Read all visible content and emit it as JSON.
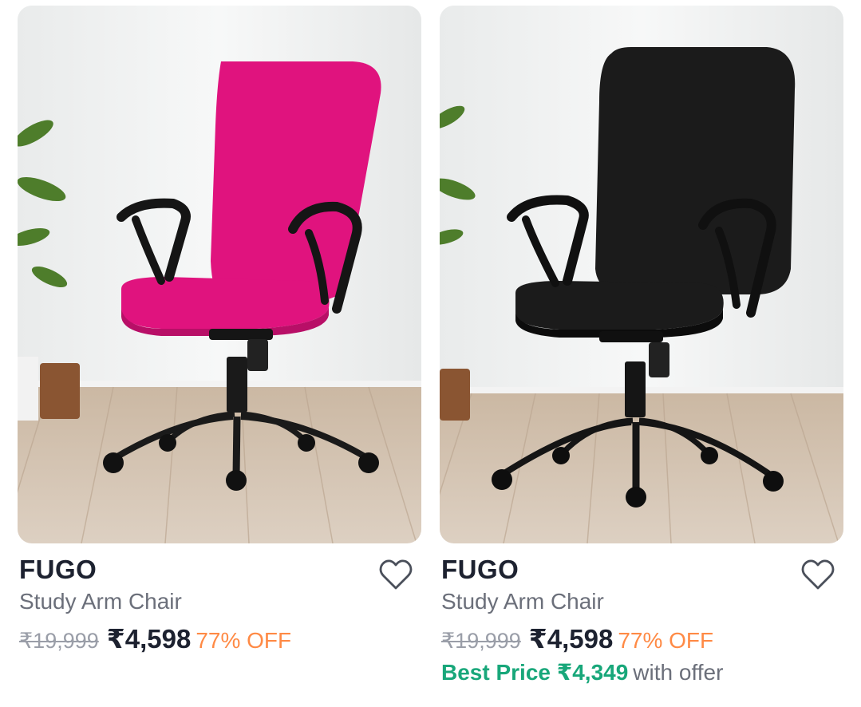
{
  "products": [
    {
      "brand": "FUGO",
      "title": "Study Arm Chair",
      "mrp": "₹19,999",
      "price": "₹4,598",
      "discount": "77% OFF",
      "chair_color": "#e0137e",
      "chair_color_dark": "#b80f67"
    },
    {
      "brand": "FUGO",
      "title": "Study Arm Chair",
      "mrp": "₹19,999",
      "price": "₹4,598",
      "discount": "77% OFF",
      "best_price": "Best Price ₹4,349",
      "best_price_suffix": "with offer",
      "chair_color": "#1b1b1b",
      "chair_color_dark": "#0c0c0c"
    }
  ],
  "colors": {
    "brand_text": "#1d2230",
    "muted_text": "#6b6f7a",
    "discount": "#ff8a45",
    "best_price": "#18a77a"
  },
  "icons": {
    "wishlist": "heart-outline-icon"
  }
}
